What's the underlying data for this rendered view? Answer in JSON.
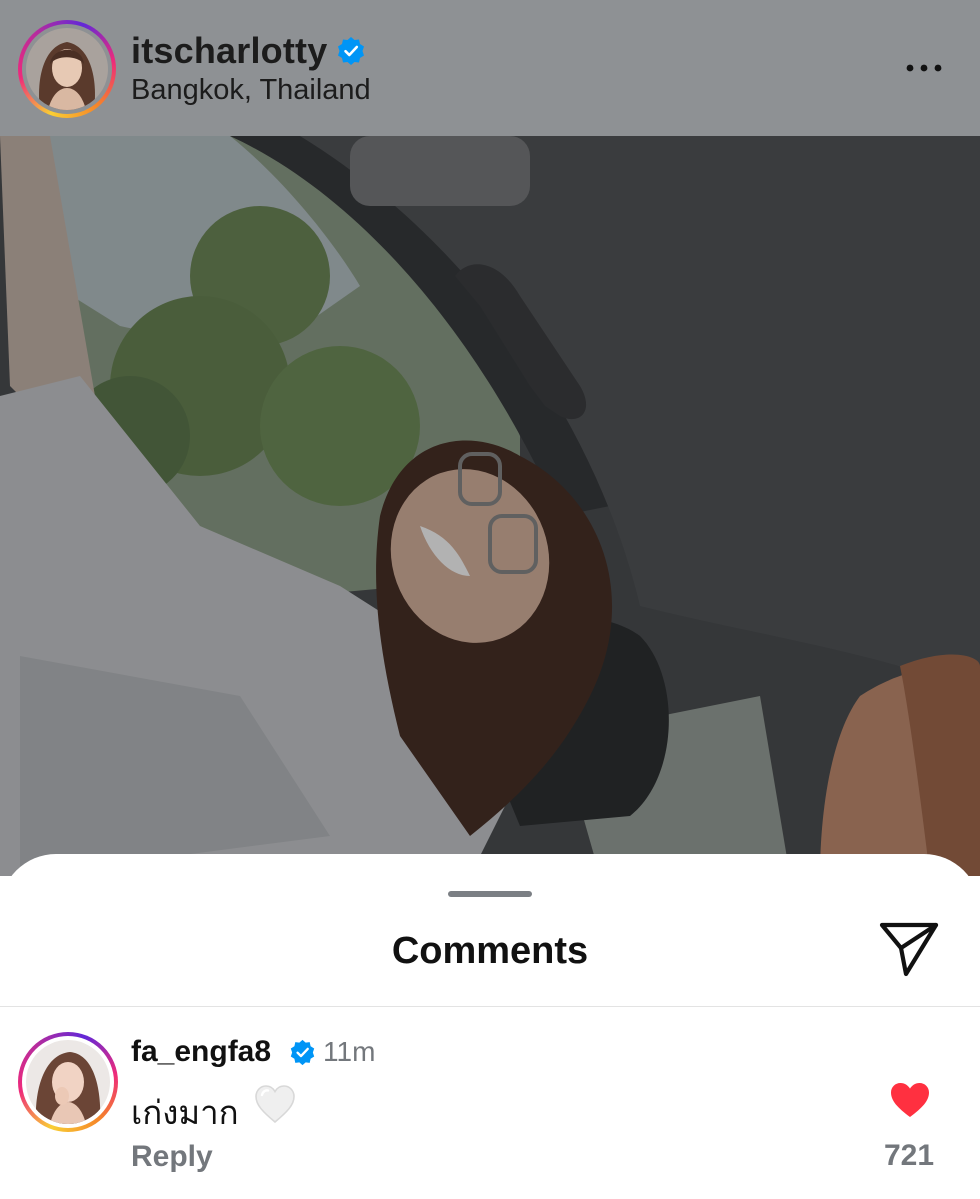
{
  "post": {
    "username": "itscharlotty",
    "verified": true,
    "location": "Bangkok, Thailand",
    "more_icon": "more-horizontal-icon"
  },
  "sheet": {
    "title": "Comments",
    "share_icon": "send-icon"
  },
  "comments": [
    {
      "username": "fa_engfa8",
      "verified": true,
      "time": "11m",
      "text": "เก่งมาก",
      "emoji": "white-heart-icon",
      "reply_label": "Reply",
      "like_count": "721",
      "liked": true
    }
  ],
  "colors": {
    "header_overlay": "#8e9194",
    "verified_blue": "#0095f6",
    "like_red": "#ff3040",
    "muted_text": "#73777c"
  }
}
